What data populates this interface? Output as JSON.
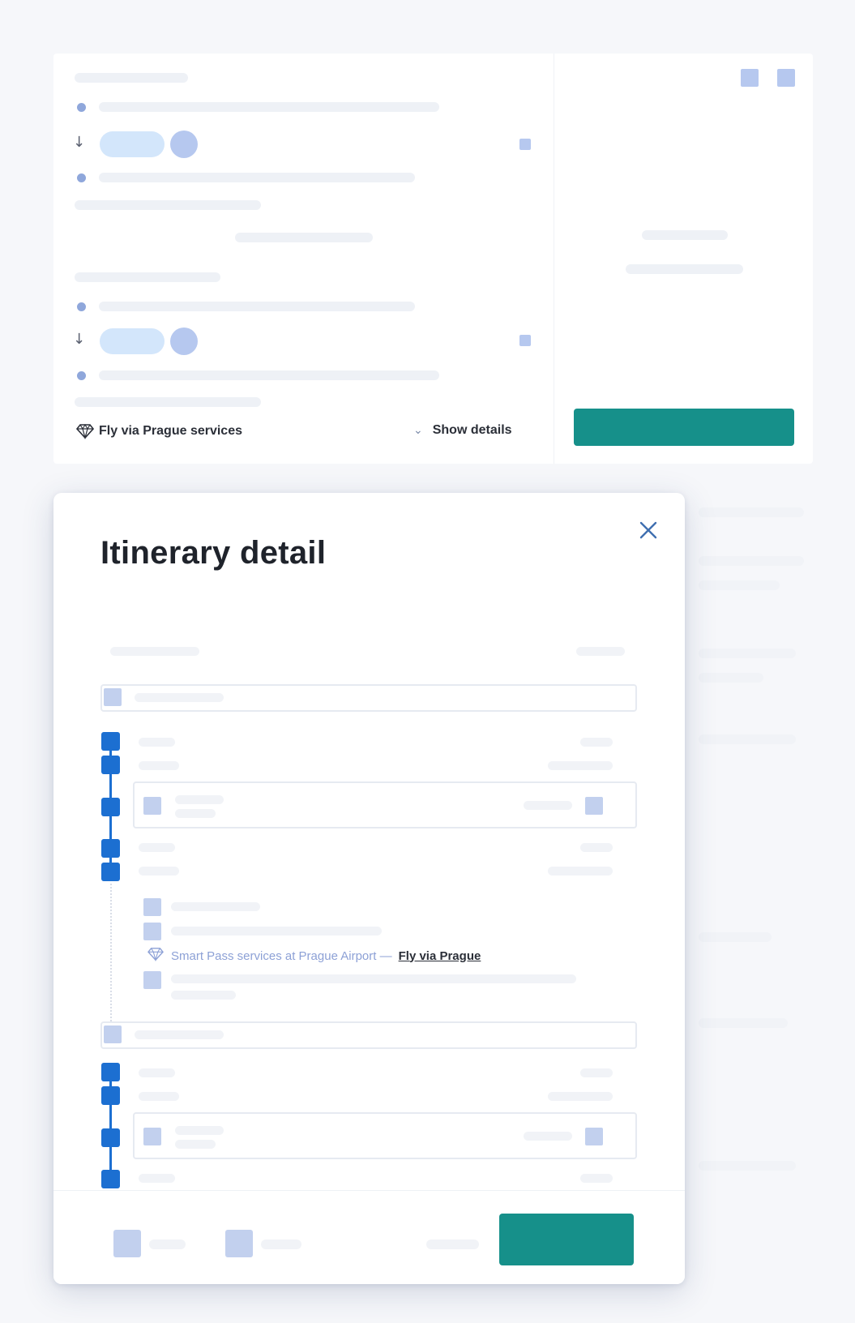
{
  "background": {
    "fvp_services_label": "Fly via Prague services",
    "show_details_label": "Show details"
  },
  "modal": {
    "title": "Itinerary detail",
    "smart_pass_text": "Smart Pass services at Prague Airport —",
    "smart_pass_link": "Fly via Prague"
  },
  "colors": {
    "accent_teal": "#16908a",
    "timeline_blue": "#1c6fd1",
    "placeholder_blue": "#b6c8ef"
  },
  "icons": {
    "close": "close-icon",
    "gem": "gem-icon",
    "chevron": "chevron-down-icon"
  }
}
